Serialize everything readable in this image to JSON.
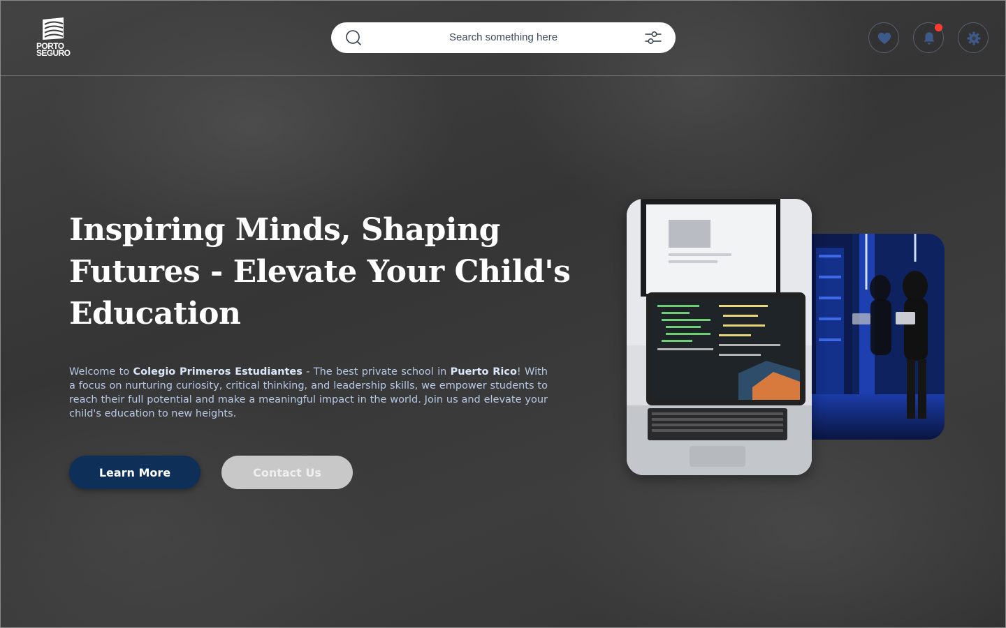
{
  "brand": {
    "logo_line1": "PORTO",
    "logo_line2": "SEGURO"
  },
  "search": {
    "placeholder": "Search something here",
    "icon": "search-icon",
    "filter_icon": "sliders-icon"
  },
  "header_actions": [
    {
      "icon": "heart-icon"
    },
    {
      "icon": "bell-icon",
      "has_notification": true
    },
    {
      "icon": "gear-icon"
    }
  ],
  "hero": {
    "title": "Inspiring Minds, Shaping Futures - Elevate Your Child's Education",
    "desc_part1": "Welcome to ",
    "desc_school": "Colegio Primeros Estudiantes",
    "desc_part2": " - The best private school in ",
    "desc_place": "Puerto Rico",
    "desc_part3": "! With a focus on nurturing curiosity, critical thinking, and leadership skills, we empower students to reach their full potential and make a meaningful impact in the world. Join us and elevate your child's education to new heights."
  },
  "buttons": {
    "learn_more": "Learn More",
    "contact_us": "Contact Us"
  },
  "colors": {
    "primary": "#0e2f57",
    "accent_text": "#b7c9e6",
    "notification": "#ff3b30",
    "icon": "#3e5a8a"
  }
}
